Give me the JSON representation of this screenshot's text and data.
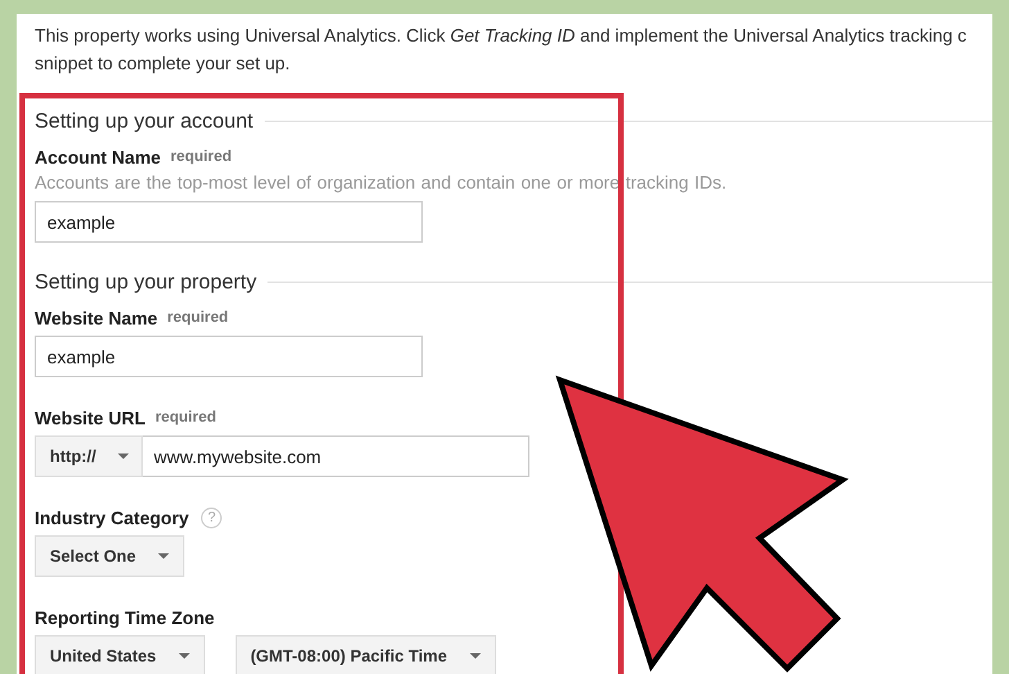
{
  "intro_lines": [
    "This property works using Universal Analytics. Click *Get Tracking ID* and implement the Universal Analytics tracking c",
    "snippet to complete your set up."
  ],
  "sections": [
    {
      "heading": "Setting up your account",
      "fields": [
        {
          "kind": "text",
          "label": "Account Name",
          "required": "required",
          "description": "Accounts are the top-most level of organization and contain one or more tracking IDs.",
          "value": "example"
        }
      ]
    },
    {
      "heading": "Setting up your property",
      "fields": [
        {
          "kind": "text",
          "label": "Website Name",
          "required": "required",
          "value": "example"
        },
        {
          "kind": "url",
          "label": "Website URL",
          "required": "required",
          "protocol": "http://",
          "value": "www.mywebsite.com"
        },
        {
          "kind": "select",
          "label": "Industry Category",
          "help": "?",
          "selects": [
            "Select One"
          ]
        },
        {
          "kind": "select",
          "label": "Reporting Time Zone",
          "selects": [
            "United States",
            "(GMT-08:00) Pacific Time"
          ]
        }
      ]
    }
  ]
}
